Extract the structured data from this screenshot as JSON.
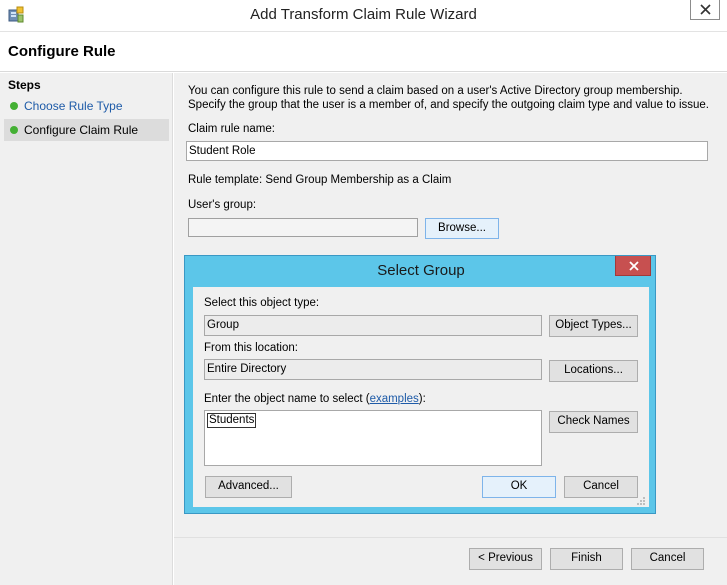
{
  "window": {
    "title": "Add Transform Claim Rule Wizard",
    "app_icon": "server-wizard-icon",
    "close_icon": "close-icon"
  },
  "header": {
    "title": "Configure Rule"
  },
  "steps": {
    "title": "Steps",
    "items": [
      {
        "label": "Choose Rule Type",
        "status": "complete",
        "is_link": true
      },
      {
        "label": "Configure Claim Rule",
        "status": "current",
        "is_link": false
      }
    ],
    "dot_color": "#44b034"
  },
  "content": {
    "description": "You can configure this rule to send a claim based on a user's Active Directory group membership. Specify the group that the user is a member of, and specify the outgoing claim type and value to issue.",
    "claim_rule_name_label": "Claim rule name:",
    "claim_rule_name_value": "Student Role",
    "rule_template": "Rule template: Send Group Membership as a Claim",
    "users_group_label": "User's group:",
    "users_group_value": "",
    "browse_label": "Browse..."
  },
  "footer": {
    "previous_label": "< Previous",
    "finish_label": "Finish",
    "cancel_label": "Cancel"
  },
  "select_group_dialog": {
    "title": "Select Group",
    "object_type_label": "Select this object type:",
    "object_type_value": "Group",
    "object_types_button": "Object Types...",
    "location_label": "From this location:",
    "location_value": "Entire Directory",
    "locations_button": "Locations...",
    "enter_name_label_prefix": "Enter the object name to select (",
    "enter_name_label_link": "examples",
    "enter_name_label_suffix": "):",
    "object_name_value": "Students",
    "check_names_button": "Check Names",
    "advanced_button": "Advanced...",
    "ok_button": "OK",
    "cancel_button": "Cancel",
    "title_bar_color": "#5cc6e9",
    "close_button_color": "#c75050"
  }
}
